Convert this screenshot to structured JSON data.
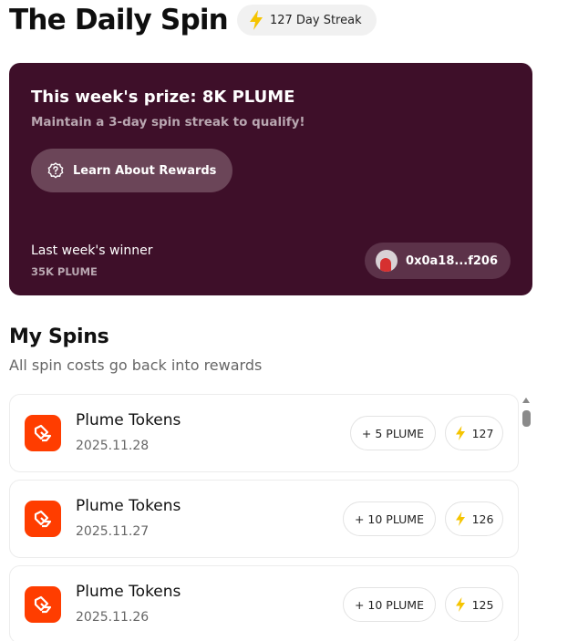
{
  "header": {
    "title": "The Daily Spin",
    "streak_label": "127 Day Streak"
  },
  "prize": {
    "title": "This week's prize: 8K PLUME",
    "subtitle": "Maintain a 3-day spin streak to qualify!",
    "learn_button": "Learn About Rewards",
    "winner_label": "Last week's winner",
    "winner_amount": "35K PLUME",
    "winner_address": "0x0a18...f206"
  },
  "spins": {
    "title": "My Spins",
    "subtitle": "All spin costs go back into rewards",
    "items": [
      {
        "name": "Plume Tokens",
        "date": "2025.11.28",
        "amount": "+ 5 PLUME",
        "count": "127"
      },
      {
        "name": "Plume Tokens",
        "date": "2025.11.27",
        "amount": "+ 10 PLUME",
        "count": "126"
      },
      {
        "name": "Plume Tokens",
        "date": "2025.11.26",
        "amount": "+ 10 PLUME",
        "count": "125"
      }
    ]
  },
  "colors": {
    "prize_card_bg": "#3e0f29",
    "accent_orange": "#ff3d00",
    "bolt_yellow": "#f5c400"
  },
  "icons": [
    "lightning-bolt-icon",
    "question-badge-icon",
    "plume-token-icon",
    "avatar",
    "scroll-up-arrow"
  ]
}
